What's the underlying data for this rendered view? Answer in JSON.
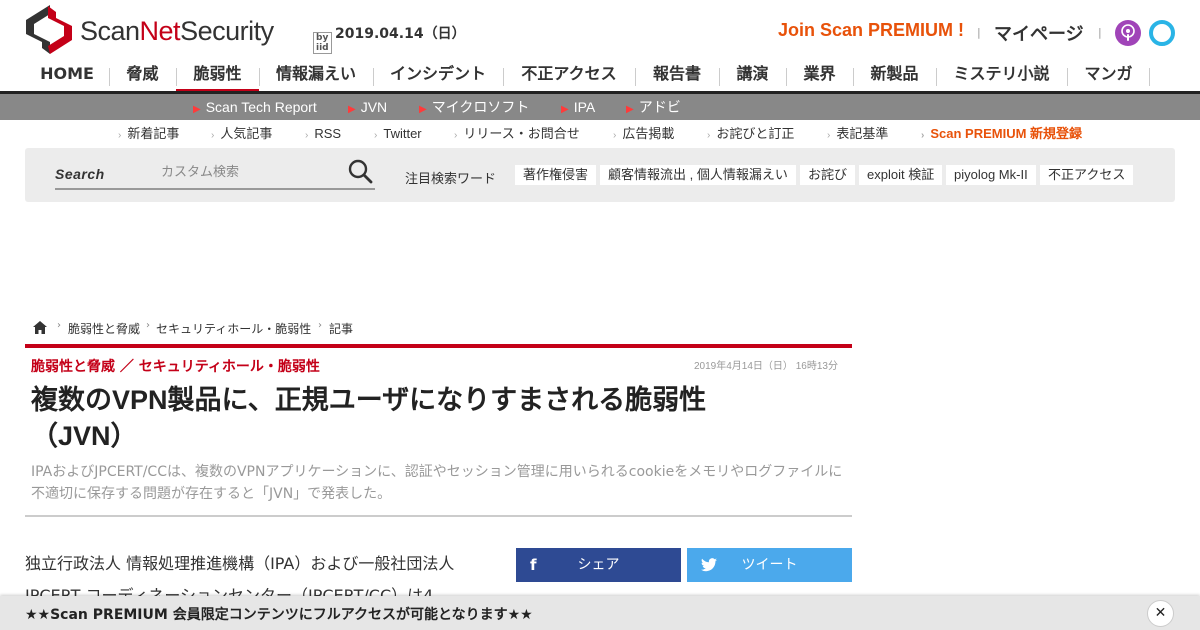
{
  "header": {
    "logo_prefix": "Scan",
    "logo_net": "Net",
    "logo_suffix": "Security",
    "logo_byiid": "by iid",
    "date": "2019.04.14（日）",
    "join_premium": "Join Scan PREMIUM !",
    "separator": "|",
    "mypage": "マイページ"
  },
  "nav": {
    "items": [
      "HOME",
      "脅威",
      "脆弱性",
      "情報漏えい",
      "インシデント",
      "不正アクセス",
      "報告書",
      "講演",
      "業界",
      "新製品",
      "ミステリ小説",
      "マンガ"
    ],
    "active": "脆弱性"
  },
  "subnav": {
    "items": [
      "Scan Tech Report",
      "JVN",
      "マイクロソフト",
      "IPA",
      "アドビ"
    ]
  },
  "util_links": {
    "items": [
      "新着記事",
      "人気記事",
      "RSS",
      "Twitter",
      "リリース・お問合せ",
      "広告掲載",
      "お詫びと訂正",
      "表記基準"
    ],
    "premium": "Scan PREMIUM 新規登録"
  },
  "search": {
    "label": "Search",
    "placeholder": "カスタム検索",
    "trend_label": "注目検索ワード",
    "tags": [
      "著作権侵害",
      "顧客情報流出 , 個人情報漏えい",
      "お詫び",
      "exploit 検証",
      "piyolog Mk-II",
      "不正アクセス"
    ]
  },
  "breadcrumb": {
    "sep": "›",
    "items": [
      "脆弱性と脅威",
      "セキュリティホール・脆弱性",
      "記事"
    ]
  },
  "article": {
    "category": "脆弱性と脅威 ／ セキュリティホール・脆弱性",
    "date": "2019年4月14日（日） 16時13分",
    "title": "複数のVPN製品に、正規ユーザになりすまされる脆弱性（JVN）",
    "lead": "IPAおよびJPCERT/CCは、複数のVPNアプリケーションに、認証やセッション管理に用いられるcookieをメモリやログファイルに不適切に保存する問題が存在すると「JVN」で発表した。",
    "body": "独立行政法人 情報処理推進機構（IPA）および一般社団法人 JPCERT コーディネーションセンター（JPCERT/CC）は4",
    "share_label": "シェア",
    "share_icon": "f",
    "tweet_label": "ツイート"
  },
  "banner": {
    "text": "★★Scan PREMIUM 会員限定コンテンツにフルアクセスが可能となります★★",
    "close": "✕"
  },
  "colors": {
    "brand_red": "#c40018",
    "premium_orange": "#e8520a",
    "facebook": "#2e4a93",
    "twitter": "#4ba9ec"
  }
}
